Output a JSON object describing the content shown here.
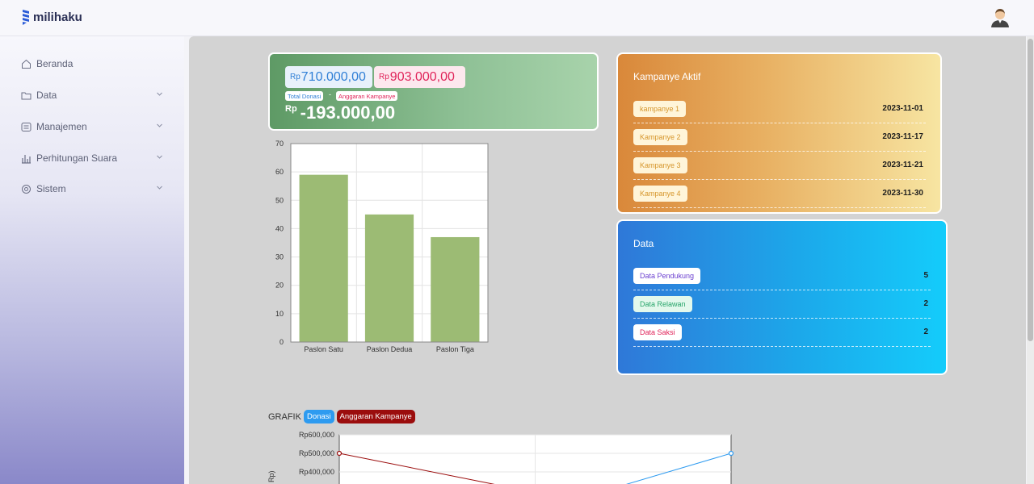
{
  "app": {
    "brand": "milihaku"
  },
  "sidebar": {
    "items": [
      {
        "label": "Beranda",
        "icon": "home-icon",
        "has_submenu": false
      },
      {
        "label": "Data",
        "icon": "folder-icon",
        "has_submenu": true
      },
      {
        "label": "Manajemen",
        "icon": "list-icon",
        "has_submenu": true
      },
      {
        "label": "Perhitungan Suara",
        "icon": "bar-chart-icon",
        "has_submenu": true
      },
      {
        "label": "Sistem",
        "icon": "gear-icon",
        "has_submenu": true
      }
    ]
  },
  "finance": {
    "currency": "Rp",
    "total_donasi": "710.000,00",
    "anggaran_kampanye": "903.000,00",
    "total_donasi_label": "Total Donasi",
    "separator": "-",
    "anggaran_label": "Anggaran Kampanye",
    "difference": "-193.000,00"
  },
  "kampanye": {
    "title": "Kampanye Aktif",
    "items": [
      {
        "name": "kampanye 1",
        "date": "2023-11-01"
      },
      {
        "name": "Kampanye 2",
        "date": "2023-11-17"
      },
      {
        "name": "Kampanye 3",
        "date": "2023-11-21"
      },
      {
        "name": "Kampanye 4",
        "date": "2023-11-30"
      }
    ]
  },
  "data_card": {
    "title": "Data",
    "items": [
      {
        "label": "Data Pendukung",
        "value": "5",
        "color": "#6a3fd0"
      },
      {
        "label": "Data Relawan",
        "value": "2",
        "color": "#27a56a"
      },
      {
        "label": "Data Saksi",
        "value": "2",
        "color": "#e0245a"
      }
    ]
  },
  "grafik": {
    "title": "GRAFIK",
    "legend": [
      {
        "label": "Donasi",
        "color": "#2e9bf0"
      },
      {
        "label": "Anggaran Kampanye",
        "color": "#9b0d0d"
      }
    ]
  },
  "chart_data": [
    {
      "type": "bar",
      "categories": [
        "Paslon Satu",
        "Paslon Dedua",
        "Paslon Tiga"
      ],
      "values": [
        59,
        45,
        37
      ],
      "ylim": [
        0,
        70
      ],
      "yticks": [
        0,
        10,
        20,
        30,
        40,
        50,
        60,
        70
      ],
      "color": "#9cbb74",
      "grid": true
    },
    {
      "type": "line",
      "ylabel_fragment": "Rp)",
      "yticks_visible": [
        "Rp600,000",
        "Rp500,000",
        "Rp400,000"
      ],
      "ylim_visible": [
        400000,
        600000
      ],
      "series": [
        {
          "name": "Donasi",
          "color": "#2e9bf0",
          "visible_points": [
            [
              1,
              500000
            ]
          ]
        },
        {
          "name": "Anggaran Kampanye",
          "color": "#9b0d0d",
          "visible_points": [
            [
              0,
              500000
            ]
          ]
        }
      ]
    }
  ]
}
